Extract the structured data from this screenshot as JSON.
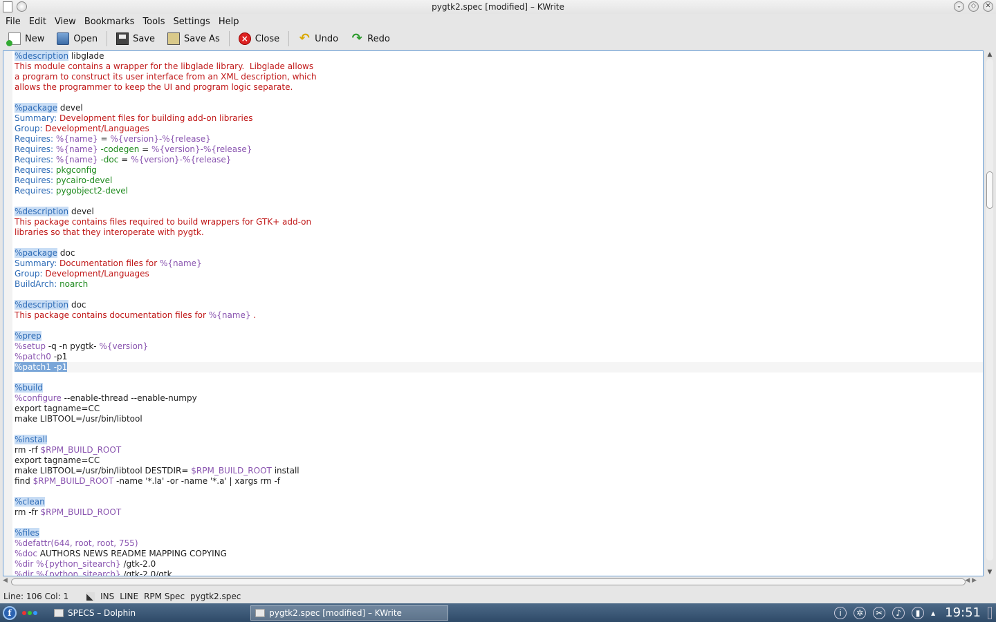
{
  "window": {
    "title": "pygtk2.spec [modified] – KWrite"
  },
  "menu": [
    {
      "label": "File"
    },
    {
      "label": "Edit"
    },
    {
      "label": "View"
    },
    {
      "label": "Bookmarks"
    },
    {
      "label": "Tools"
    },
    {
      "label": "Settings"
    },
    {
      "label": "Help"
    }
  ],
  "toolbar": {
    "new_label": "New",
    "open_label": "Open",
    "save_label": "Save",
    "saveas_label": "Save As",
    "close_label": "Close",
    "undo_label": "Undo",
    "redo_label": "Redo"
  },
  "editor": {
    "current_line_index": 30,
    "lines": [
      [
        [
          "hl k",
          "%description"
        ],
        [
          "",
          "libglade"
        ]
      ],
      [
        [
          "r",
          "This module contains a wrapper for the libglade library.  Libglade allows"
        ]
      ],
      [
        [
          "r",
          "a program to construct its user interface from an XML description, which"
        ]
      ],
      [
        [
          "r",
          "allows the programmer to keep the UI and program logic separate."
        ]
      ],
      [],
      [
        [
          "hl k",
          "%package"
        ],
        [
          "",
          "devel"
        ]
      ],
      [
        [
          "k",
          "Summary:"
        ],
        [
          "r",
          "Development files for building add-on libraries"
        ]
      ],
      [
        [
          "k",
          "Group:"
        ],
        [
          "r",
          "Development/Languages"
        ]
      ],
      [
        [
          "k",
          "Requires:"
        ],
        [
          "m",
          "%{name}"
        ],
        [
          "",
          "="
        ],
        [
          "m",
          "%{version}-%{release}"
        ]
      ],
      [
        [
          "k",
          "Requires:"
        ],
        [
          "m",
          "%{name}"
        ],
        [
          "g",
          "-codegen"
        ],
        [
          "",
          "="
        ],
        [
          "m",
          "%{version}-%{release}"
        ]
      ],
      [
        [
          "k",
          "Requires:"
        ],
        [
          "m",
          "%{name}"
        ],
        [
          "g",
          "-doc"
        ],
        [
          "",
          "="
        ],
        [
          "m",
          "%{version}-%{release}"
        ]
      ],
      [
        [
          "k",
          "Requires:"
        ],
        [
          "g",
          "pkgconfig"
        ]
      ],
      [
        [
          "k",
          "Requires:"
        ],
        [
          "g",
          "pycairo-devel"
        ]
      ],
      [
        [
          "k",
          "Requires:"
        ],
        [
          "g",
          "pygobject2-devel"
        ]
      ],
      [],
      [
        [
          "hl k",
          "%description"
        ],
        [
          "",
          "devel"
        ]
      ],
      [
        [
          "r",
          "This package contains files required to build wrappers for GTK+ add-on"
        ]
      ],
      [
        [
          "r",
          "libraries so that they interoperate with pygtk."
        ]
      ],
      [],
      [
        [
          "hl k",
          "%package"
        ],
        [
          "",
          "doc"
        ]
      ],
      [
        [
          "k",
          "Summary:"
        ],
        [
          "r",
          "Documentation files for"
        ],
        [
          "m",
          "%{name}"
        ]
      ],
      [
        [
          "k",
          "Group:"
        ],
        [
          "r",
          "Development/Languages"
        ]
      ],
      [
        [
          "k",
          "BuildArch:"
        ],
        [
          "g",
          "noarch"
        ]
      ],
      [],
      [
        [
          "hl k",
          "%description"
        ],
        [
          "",
          "doc"
        ]
      ],
      [
        [
          "r",
          "This package contains documentation files for"
        ],
        [
          "m",
          "%{name}"
        ],
        [
          "r",
          "."
        ]
      ],
      [],
      [
        [
          "hl k",
          "%prep"
        ]
      ],
      [
        [
          "m",
          "%setup"
        ],
        [
          "",
          "-q -n pygtk-"
        ],
        [
          "m",
          "%{version}"
        ]
      ],
      [
        [
          "m",
          "%patch0"
        ],
        [
          "",
          "-p1"
        ]
      ],
      [
        [
          "sel",
          "%patch1 -p1"
        ]
      ],
      [],
      [
        [
          "hl k",
          "%build"
        ]
      ],
      [
        [
          "m",
          "%configure"
        ],
        [
          "",
          "--enable-thread --enable-numpy"
        ]
      ],
      [
        [
          "",
          "export tagname=CC"
        ]
      ],
      [
        [
          "",
          "make LIBTOOL=/usr/bin/libtool"
        ]
      ],
      [],
      [
        [
          "hl k",
          "%install"
        ]
      ],
      [
        [
          "",
          "rm -rf"
        ],
        [
          "m",
          "$RPM_BUILD_ROOT"
        ]
      ],
      [
        [
          "",
          "export tagname=CC"
        ]
      ],
      [
        [
          "",
          "make LIBTOOL=/usr/bin/libtool DESTDIR="
        ],
        [
          "m",
          "$RPM_BUILD_ROOT"
        ],
        [
          "",
          "install"
        ]
      ],
      [
        [
          "",
          "find"
        ],
        [
          "m",
          "$RPM_BUILD_ROOT"
        ],
        [
          "",
          "-name '*.la' -or -name '*.a' | xargs rm -f"
        ]
      ],
      [],
      [
        [
          "hl k",
          "%clean"
        ]
      ],
      [
        [
          "",
          "rm -fr"
        ],
        [
          "m",
          "$RPM_BUILD_ROOT"
        ]
      ],
      [],
      [
        [
          "hl k",
          "%files"
        ]
      ],
      [
        [
          "m",
          "%defattr(644, root, root, 755)"
        ]
      ],
      [
        [
          "m",
          "%doc"
        ],
        [
          "",
          "AUTHORS NEWS README MAPPING COPYING"
        ]
      ],
      [
        [
          "m",
          "%dir"
        ],
        [
          "m",
          "%{python_sitearch}"
        ],
        [
          "",
          "/gtk-2.0"
        ]
      ],
      [
        [
          "m",
          "%dir"
        ],
        [
          "m",
          "%{python_sitearch}"
        ],
        [
          "",
          "/gtk-2.0/gtk"
        ]
      ]
    ]
  },
  "status": {
    "position": "Line: 106 Col: 1",
    "mode": "INS",
    "selection": "LINE",
    "syntax": "RPM Spec",
    "filename": "pygtk2.spec"
  },
  "taskbar": {
    "tasks": [
      {
        "label": "SPECS – Dolphin"
      },
      {
        "label": "pygtk2.spec [modified] – KWrite"
      }
    ],
    "clock": "19:51"
  }
}
